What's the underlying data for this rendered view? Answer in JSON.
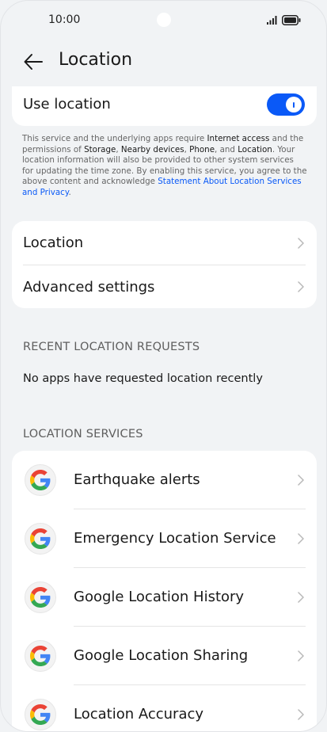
{
  "status": {
    "time": "10:00"
  },
  "header": {
    "title": "Location"
  },
  "use_location": {
    "label": "Use location",
    "enabled": true
  },
  "notice": {
    "t1": "This service and the underlying apps require ",
    "b1": "Internet access",
    "t2": " and the permissions of ",
    "b2": "Storage",
    "t3": ", ",
    "b3": "Nearby devices",
    "t4": ", ",
    "b4": "Phone",
    "t5": ", and ",
    "b5": "Location",
    "t6": ". Your location information will also be provided to other system services for updating the time zone. By enabling this service, you agree to the above content and acknowledge ",
    "link": "Statement About Location Services and Privacy",
    "t7": "."
  },
  "menu": {
    "items": [
      {
        "label": "Location"
      },
      {
        "label": "Advanced settings"
      }
    ]
  },
  "recent": {
    "title": "RECENT LOCATION REQUESTS",
    "empty": "No apps have requested location recently"
  },
  "services": {
    "title": "LOCATION SERVICES",
    "items": [
      {
        "label": "Earthquake alerts",
        "icon": "google-icon"
      },
      {
        "label": "Emergency Location Service",
        "icon": "google-icon"
      },
      {
        "label": "Google Location History",
        "icon": "google-icon"
      },
      {
        "label": "Google Location Sharing",
        "icon": "google-icon"
      },
      {
        "label": "Location Accuracy",
        "icon": "google-icon"
      }
    ]
  },
  "colors": {
    "accent": "#0a59f7",
    "background": "#f1f3f5",
    "card": "#ffffff"
  }
}
